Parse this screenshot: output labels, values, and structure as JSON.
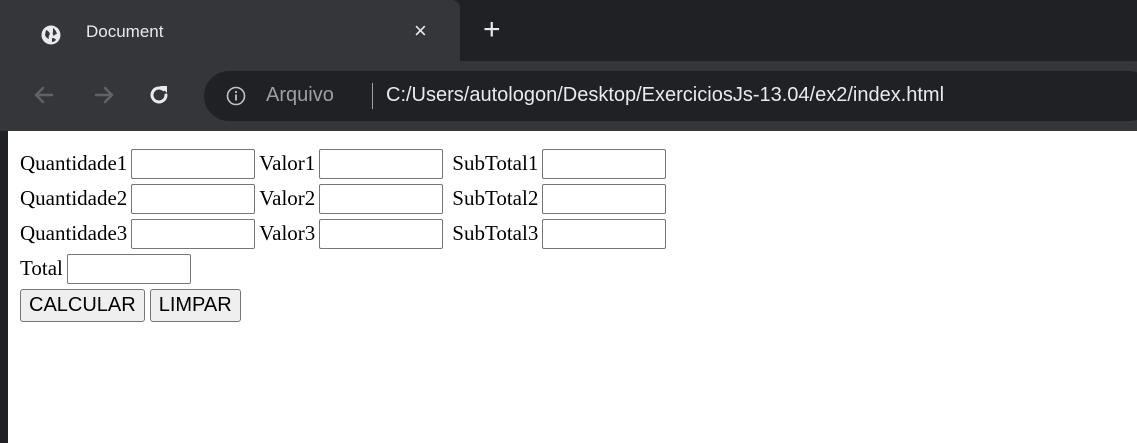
{
  "browser": {
    "tab_title": "Document",
    "tab_close": "×",
    "new_tab": "+",
    "scheme_label": "Arquivo",
    "url": "C:/Users/autologon/Desktop/ExerciciosJs-13.04/ex2/index.html",
    "icons": {
      "tab_favicon": "globe-icon",
      "back": "arrow-left-icon",
      "forward": "arrow-right-icon",
      "reload": "reload-icon",
      "info": "info-icon"
    },
    "colors": {
      "tabstrip": "#202124",
      "tab_active": "#35363a",
      "toolbar": "#35363a",
      "omnibox": "#202124",
      "text_light": "#e8eaed",
      "text_dim": "#9aa0a6"
    }
  },
  "form": {
    "rows": [
      {
        "qty_label": "Quantidade1",
        "qty_value": "",
        "val_label": "Valor1",
        "val_value": "",
        "sub_label": "SubTotal1",
        "sub_value": ""
      },
      {
        "qty_label": "Quantidade2",
        "qty_value": "",
        "val_label": "Valor2",
        "val_value": "",
        "sub_label": "SubTotal2",
        "sub_value": ""
      },
      {
        "qty_label": "Quantidade3",
        "qty_value": "",
        "val_label": "Valor3",
        "val_value": "",
        "sub_label": "SubTotal3",
        "sub_value": ""
      }
    ],
    "total_label": "Total",
    "total_value": "",
    "calcular_label": "CALCULAR",
    "limpar_label": "LIMPAR"
  }
}
